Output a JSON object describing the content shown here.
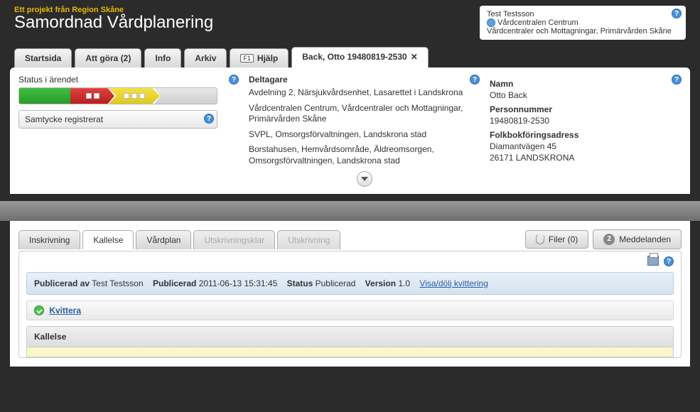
{
  "header": {
    "subtitle": "Ett projekt från Region Skåne",
    "title": "Samordnad Vårdplanering",
    "user": {
      "name": "Test Testsson",
      "unit": "Vårdcentralen Centrum",
      "org": "Vårdcentraler och Mottagningar, Primärvården Skåne"
    }
  },
  "tabs": {
    "startsida": "Startsida",
    "att_gora": "Att göra (2)",
    "info": "Info",
    "arkiv": "Arkiv",
    "hjalp": "Hjälp",
    "f1": "F1",
    "patient": "Back, Otto 19480819-2530",
    "close": "✕"
  },
  "status": {
    "title": "Status i ärendet",
    "consent": "Samtycke registrerat"
  },
  "deltagare": {
    "title": "Deltagare",
    "items": [
      "Avdelning 2, Närsjukvårdsenhet, Lasarettet i Landskrona",
      "Vårdcentralen Centrum, Vårdcentraler och Mottagningar, Primärvården Skåne",
      "SVPL, Omsorgsförvaltningen, Landskrona stad",
      "Borstahusen, Hemvårdsområde, Äldreomsorgen, Omsorgsförvaltningen, Landskrona stad"
    ]
  },
  "person": {
    "namn_lbl": "Namn",
    "namn": "Otto Back",
    "pnr_lbl": "Personnummer",
    "pnr": "19480819-2530",
    "addr_lbl": "Folkbokföringsadress",
    "addr1": "Diamantvägen 45",
    "addr2": "26171 LANDSKRONA"
  },
  "subtabs": {
    "inskrivning": "Inskrivning",
    "kallelse": "Kallelse",
    "vardplan": "Vårdplan",
    "utskrivningsklar": "Utskrivningsklar",
    "utskrivning": "Utskrivning"
  },
  "tools": {
    "filer": "Filer (0)",
    "meddelanden": "Meddelanden",
    "msg_count": "2"
  },
  "pubbar": {
    "pub_by_lbl": "Publicerad av",
    "pub_by": "Test Testsson",
    "pub_lbl": "Publicerad",
    "pub_date": "2011-06-13 15:31:45",
    "status_lbl": "Status",
    "status": "Publicerad",
    "version_lbl": "Version",
    "version": "1.0",
    "toggle": "Visa/dölj kvittering"
  },
  "kvittera": "Kvittera",
  "kallelse_header": "Kallelse"
}
